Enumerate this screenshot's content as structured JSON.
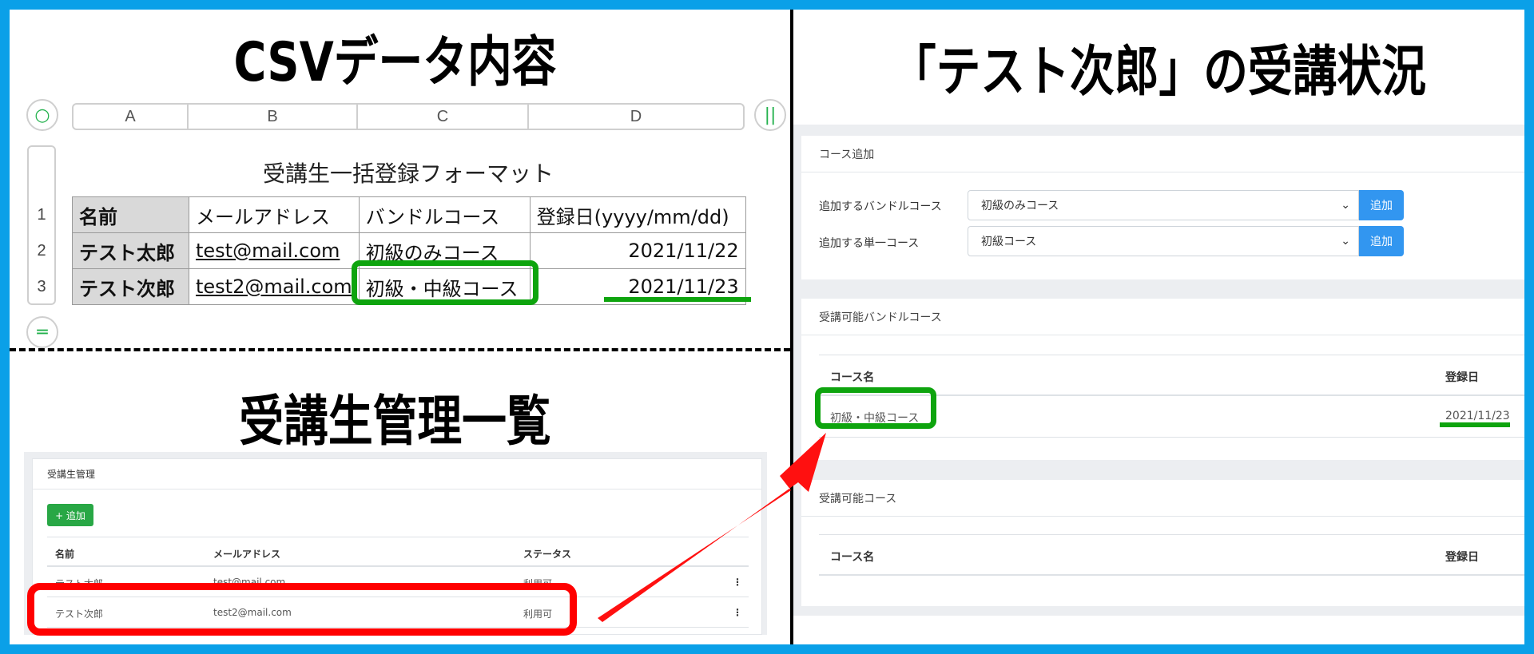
{
  "headings": {
    "csv": "CSVデータ内容",
    "list": "受講生管理一覧",
    "status": "「テスト次郎」の受講状況"
  },
  "spreadsheet": {
    "columns": [
      "A",
      "B",
      "C",
      "D"
    ],
    "rows": [
      "1",
      "2",
      "3"
    ],
    "title": "受講生一括登録フォーマット",
    "header": [
      "名前",
      "メールアドレス",
      "バンドルコース",
      "登録日(yyyy/mm/dd)"
    ],
    "data": [
      [
        "テスト太郎",
        "test@mail.com",
        "初級のみコース",
        "2021/11/22"
      ],
      [
        "テスト次郎",
        "test2@mail.com",
        "初級・中級コース",
        "2021/11/23"
      ]
    ]
  },
  "student_list": {
    "panel_title": "受講生管理",
    "add_button": "+ 追加",
    "columns": [
      "名前",
      "メールアドレス",
      "ステータス"
    ],
    "rows": [
      {
        "name": "テスト太郎",
        "email": "test@mail.com",
        "status": "利用可",
        "menu": "⋮"
      },
      {
        "name": "テスト次郎",
        "email": "test2@mail.com",
        "status": "利用可",
        "menu": "⋮"
      }
    ]
  },
  "course_status": {
    "add_card": {
      "title": "コース追加",
      "bundle_label": "追加するバンドルコース",
      "bundle_value": "初級のみコース",
      "single_label": "追加する単一コース",
      "single_value": "初級コース",
      "add_button": "追加"
    },
    "bundle_card": {
      "title": "受講可能バンドルコース",
      "col_name": "コース名",
      "col_date": "登録日",
      "rows": [
        {
          "name": "初級・中級コース",
          "date": "2021/11/23"
        }
      ]
    },
    "course_card": {
      "title": "受講可能コース",
      "col_name": "コース名",
      "col_date": "登録日"
    }
  },
  "colors": {
    "frame_border": "#0aa0e8",
    "highlight_green": "#0ea40e",
    "highlight_red": "#ff0000",
    "add_button_green": "#28a745",
    "add_button_blue": "#3296f0"
  },
  "icons": {
    "select_row": "circle-icon",
    "freeze_columns": "pause-bars-icon",
    "freeze_rows": "equals-icon",
    "dropdown": "chevron-down-icon",
    "row_menu": "kebab-menu-icon",
    "pointer": "red-arrow"
  }
}
